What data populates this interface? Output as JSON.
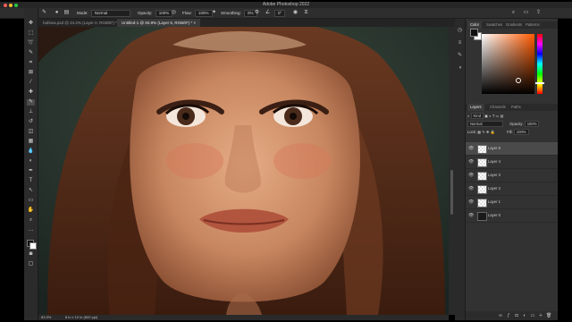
{
  "app": {
    "title": "Adobe Photoshop 2022"
  },
  "options_bar": {
    "mode_label": "Mode:",
    "mode_value": "Normal",
    "opacity_label": "Opacity:",
    "opacity_value": "100%",
    "flow_label": "Flow:",
    "flow_value": "100%",
    "smoothing_label": "Smoothing:",
    "smoothing_value": "0%",
    "angle_value": "0°"
  },
  "tabs": [
    {
      "label": "hafsiea.psd @ 24.2% (Layer 0, RGB/8*) *"
    },
    {
      "label": "Untitled-1 @ 83.9% (Layer 5, RGB/8*) *"
    }
  ],
  "status": {
    "zoom": "83.9%",
    "doc_info": "8 in x 10 in (800 ppi)"
  },
  "panels": {
    "color_tabs": [
      "Color",
      "Swatches",
      "Gradients",
      "Patterns"
    ],
    "layers_tabs": [
      "Layers",
      "Channels",
      "Paths"
    ],
    "kind_label": "Kind",
    "blend_mode": "Normal",
    "opacity_label": "Opacity:",
    "opacity_value": "100%",
    "lock_label": "Lock:",
    "fill_label": "Fill:",
    "fill_value": "100%"
  },
  "layers": [
    {
      "name": "Layer 6",
      "selected": true,
      "kind": "transparent"
    },
    {
      "name": "Layer 4",
      "selected": false,
      "kind": "transparent"
    },
    {
      "name": "Layer 3",
      "selected": false,
      "kind": "transparent"
    },
    {
      "name": "Layer 2",
      "selected": false,
      "kind": "transparent"
    },
    {
      "name": "Layer 1",
      "selected": false,
      "kind": "transparent"
    },
    {
      "name": "Layer 0",
      "selected": false,
      "kind": "image"
    }
  ],
  "colors": {
    "ui_dark": "#2b2b2b",
    "selected_layer": "#4a4a4a",
    "picker_hue": "#ff5a00",
    "traffic_red": "#ff5f57",
    "traffic_yellow": "#febc2e",
    "traffic_green": "#28c840"
  }
}
